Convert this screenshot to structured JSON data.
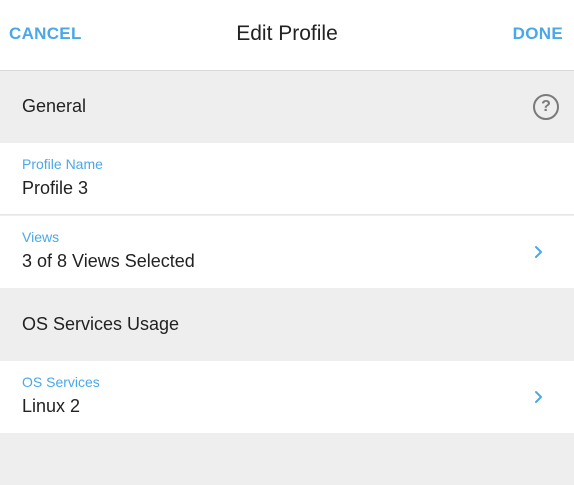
{
  "header": {
    "cancel_label": "CANCEL",
    "title": "Edit Profile",
    "done_label": "DONE"
  },
  "sections": [
    {
      "title": "General",
      "help_icon": "help-circle-icon",
      "help_glyph": "?",
      "rows": [
        {
          "label": "Profile Name",
          "value": "Profile 3"
        },
        {
          "label": "Views",
          "value": "3 of 8 Views Selected",
          "icon": "chevron-right-icon"
        }
      ]
    },
    {
      "title": "OS Services Usage",
      "rows": [
        {
          "label": "OS Services",
          "value": "Linux 2",
          "icon": "chevron-right-icon"
        }
      ]
    }
  ],
  "colors": {
    "accent": "#4aa8e8",
    "background": "#eeeeee",
    "surface": "#ffffff",
    "text": "#222222",
    "icon_gray": "#7a7a7a"
  }
}
